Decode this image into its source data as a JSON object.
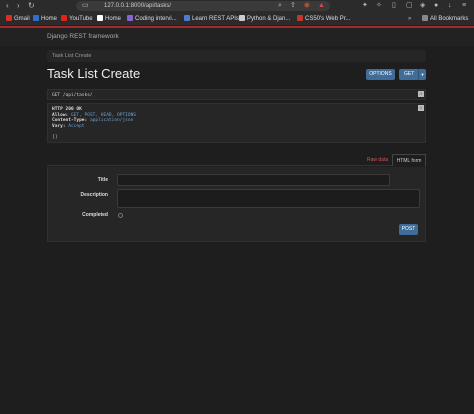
{
  "browser": {
    "url": "127.0.0.1:8000/api/tasks/",
    "bookmarks": [
      {
        "label": "Gmail",
        "color": "#d93025"
      },
      {
        "label": "Home",
        "color": "#2d6ed1"
      },
      {
        "label": "YouTube",
        "color": "#e62117"
      },
      {
        "label": "Home",
        "color": "#ffffff"
      },
      {
        "label": "Coding intervi...",
        "color": "#8a63d2"
      },
      {
        "label": "Learn REST APIs",
        "color": "#4b7bd3"
      },
      {
        "label": "Python & Djan...",
        "color": "#cccccc"
      },
      {
        "label": "CS50's Web Pr...",
        "color": "#c0392b"
      }
    ],
    "all_bookmarks": "All Bookmarks"
  },
  "drf": {
    "brand": "Django REST framework",
    "breadcrumb": "Task List Create",
    "title": "Task List Create",
    "options_label": "OPTIONS",
    "get_label": "GET",
    "request_line": "GET /api/tasks/",
    "response": {
      "status": "HTTP 200 OK",
      "allow_key": "Allow:",
      "allow_val": "GET, POST, HEAD, OPTIONS",
      "ct_key": "Content-Type:",
      "ct_val": "application/json",
      "vary_key": "Vary:",
      "vary_val": "Accept",
      "body": "[]"
    },
    "tabs": {
      "raw": "Raw data",
      "html": "HTML form"
    },
    "form": {
      "title_label": "Title",
      "description_label": "Description",
      "completed_label": "Completed",
      "post_label": "POST"
    }
  }
}
